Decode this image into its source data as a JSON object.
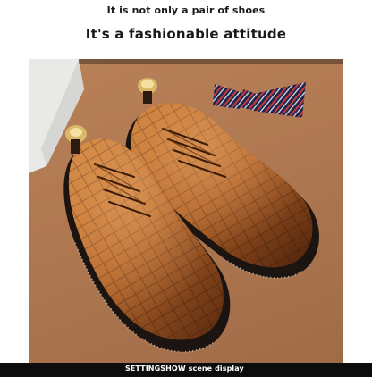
{
  "header": {
    "tagline_small": "It is not only a pair of shoes",
    "tagline_large": "It's a fashionable attitude"
  },
  "photo": {
    "subject": "pair of brown croc-embossed leather derby shoes with a striped bow tie on a leather surface"
  },
  "footer": {
    "caption": "SETTINGSHOW scene display"
  },
  "colors": {
    "background": "#ffffff",
    "caption_bar": "#0d0d0d",
    "caption_text": "#ffffff",
    "shoe_leather": "#b5652a",
    "surface": "#b07952"
  }
}
